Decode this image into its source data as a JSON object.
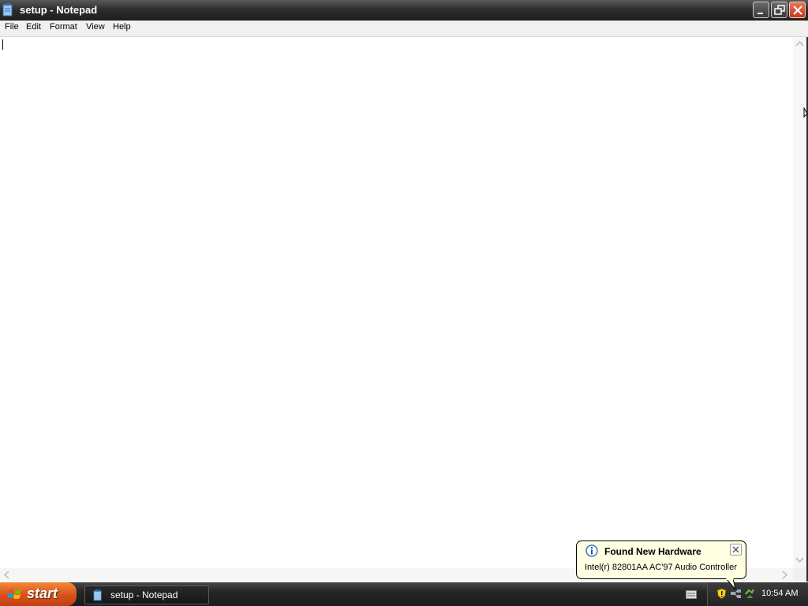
{
  "window": {
    "title": "setup - Notepad"
  },
  "menu": {
    "items": [
      "File",
      "Edit",
      "Format",
      "View",
      "Help"
    ]
  },
  "editor": {
    "content": ""
  },
  "taskbar": {
    "start_label": "start",
    "task_button_label": "setup - Notepad",
    "clock": "10:54 AM"
  },
  "balloon": {
    "title": "Found New Hardware",
    "message": "Intel(r) 82801AA AC'97 Audio Controller"
  },
  "icons": {
    "app": "notepad-icon",
    "minimize": "minimize-icon",
    "maximize": "restore-icon",
    "close": "close-icon",
    "start_flag": "windows-flag-icon",
    "info": "info-icon",
    "tray": [
      "keyboard-icon",
      "security-shield-icon",
      "network-icon",
      "safely-remove-hardware-icon"
    ]
  },
  "colors": {
    "balloon_bg": "#ffffe1",
    "start_button": "#d8501b",
    "close_button": "#c43a1a"
  }
}
